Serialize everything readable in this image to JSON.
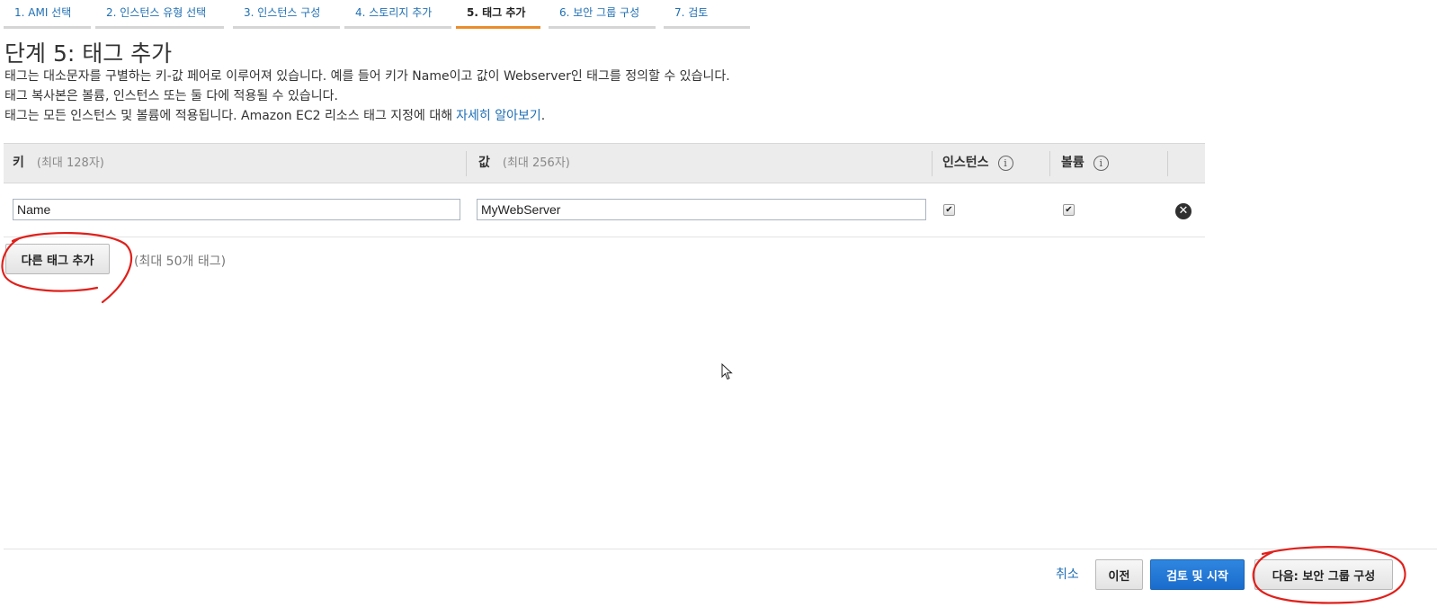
{
  "wizard": {
    "tabs": [
      {
        "label": "1. AMI 선택"
      },
      {
        "label": "2. 인스턴스 유형 선택"
      },
      {
        "label": "3. 인스턴스 구성"
      },
      {
        "label": "4. 스토리지 추가"
      },
      {
        "label": "5. 태그 추가"
      },
      {
        "label": "6. 보안 그룹 구성"
      },
      {
        "label": "7. 검토"
      }
    ],
    "active_index": 4,
    "active_color": "#eb8c2c"
  },
  "page": {
    "title": "단계 5: 태그 추가",
    "description": {
      "line1": "태그는 대소문자를 구별하는 키-값 페어로 이루어져 있습니다. 예를 들어 키가 Name이고 값이 Webserver인 태그를 정의할 수 있습니다.",
      "line2": "태그 복사본은 볼륨, 인스턴스 또는 둘 다에 적용될 수 있습니다.",
      "line3": "태그는 모든 인스턴스 및 볼륨에 적용됩니다. Amazon EC2 리소스 태그 지정에 대해",
      "learn_more_link": "자세히 알아보기",
      "line3_end": "."
    }
  },
  "tag_table": {
    "headers": {
      "key_label": "키",
      "key_hint": "(최대 128자)",
      "value_label": "값",
      "value_hint": "(최대 256자)",
      "instances_label": "인스턴스",
      "volumes_label": "볼륨"
    },
    "rows": [
      {
        "key": "Name",
        "value": "MyWebServer",
        "instances_checked": true,
        "volumes_checked": true
      }
    ],
    "add_tag_button": "다른 태그 추가",
    "add_tag_hint": "(최대 50개 태그)"
  },
  "footer": {
    "cancel": "취소",
    "previous": "이전",
    "review_and_launch": "검토 및 시작",
    "next": "다음: 보안 그룹 구성"
  },
  "colors": {
    "link": "#1f6fb4",
    "primary_button": "#1a6ccc",
    "annotation": "#e0201b"
  },
  "icons": {
    "info": "info-icon",
    "remove": "remove-circle-icon",
    "checkbox": "check-icon",
    "cursor": "mouse-cursor"
  }
}
